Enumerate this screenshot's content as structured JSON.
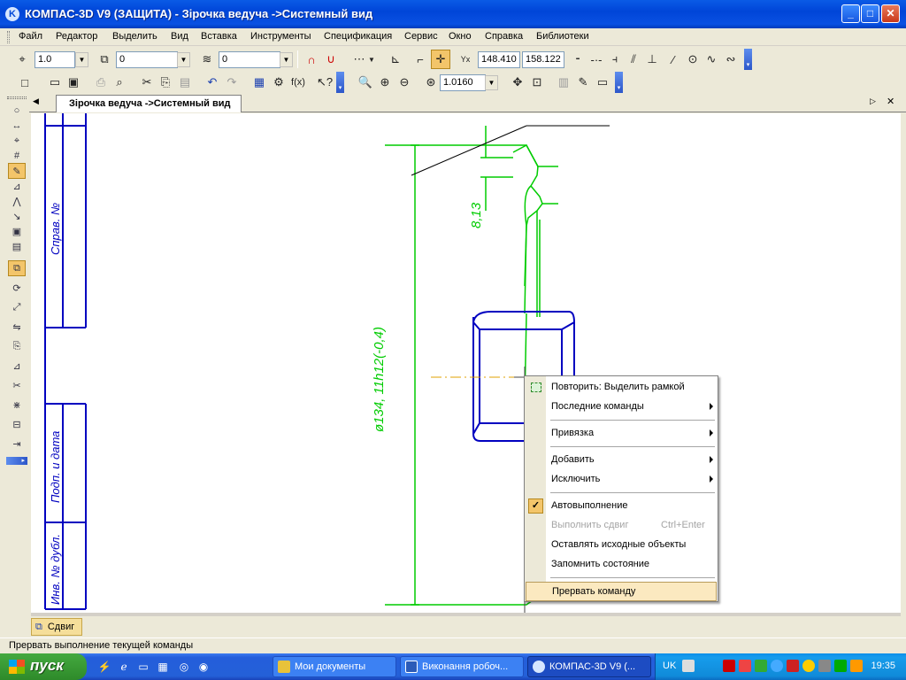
{
  "window": {
    "title": "КОМПАС-3D V9 (ЗАЩИТА) - Зірочка ведуча ->Системный вид",
    "app_icon": "kompas-logo-icon"
  },
  "menubar": {
    "items": [
      "Файл",
      "Редактор",
      "Выделить",
      "Вид",
      "Вставка",
      "Инструменты",
      "Спецификация",
      "Сервис",
      "Окно",
      "Справка",
      "Библиотеки"
    ]
  },
  "toolbar1": {
    "scale_value": "1.0",
    "layer_value": "0",
    "style_value": "0",
    "coord_x": "148.410",
    "coord_y": "158.122"
  },
  "toolbar2": {
    "zoom_value": "1.0160"
  },
  "document": {
    "tab_label": "Зірочка ведуча ->Системный вид"
  },
  "drawing": {
    "dimension_diameter": "ø134, 11h12(-0,4)",
    "dimension_depth": "8,13",
    "stamp_labels": [
      "Справ. №",
      "Подп. и дата",
      "Инв. № дубл."
    ],
    "line_color": "#00CC00",
    "frame_color": "#0000C0"
  },
  "context_menu": {
    "items": [
      {
        "label": "Повторить: Выделить рамкой",
        "icon": "select-frame-icon"
      },
      {
        "label": "Последние команды",
        "submenu": true
      },
      {
        "label": "Привязка",
        "submenu": true
      },
      {
        "label": "Добавить",
        "submenu": true
      },
      {
        "label": "Исключить",
        "submenu": true
      },
      {
        "label": "Автовыполнение",
        "checked": true
      },
      {
        "label": "Выполнить сдвиг",
        "shortcut": "Ctrl+Enter",
        "disabled": true
      },
      {
        "label": "Оставлять исходные объекты"
      },
      {
        "label": "Запомнить состояние"
      },
      {
        "label": "Прервать команду",
        "highlighted": true
      }
    ]
  },
  "command_tab": {
    "label": "Сдвиг"
  },
  "statusbar": {
    "text": "Прервать выполнение текущей команды"
  },
  "taskbar": {
    "start_label": "пуск",
    "buttons": [
      "Мои документы",
      "Виконання робоч...",
      "КОМПАС-3D V9 (..."
    ],
    "language": "UK",
    "clock": "19:35"
  }
}
